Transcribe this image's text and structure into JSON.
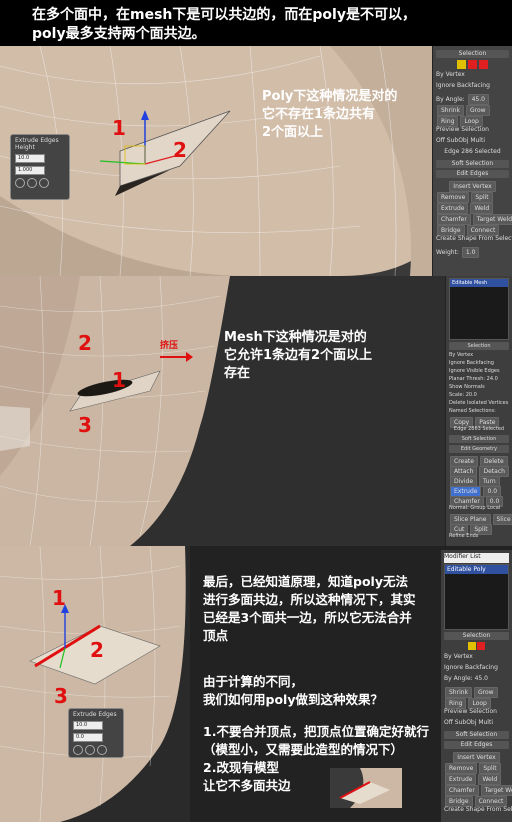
{
  "header": {
    "line1": "在多个面中，在mesh下是可以共边的，而在poly是不可以，",
    "line2": "poly最多支持两个面共边。"
  },
  "panel1": {
    "note": [
      "Poly下这种情况是对的",
      "它不存在1条边共有",
      "2个面以上"
    ],
    "marks": [
      "1",
      "2"
    ],
    "popup": {
      "title": "Extrude Edges",
      "subtitle": "Height",
      "v1": "10.0",
      "v2": "1.000"
    },
    "side": {
      "selection": "Selection",
      "by_vertex": "By Vertex",
      "ignore_backfacing": "Ignore Backfacing",
      "by_angle": "By Angle:",
      "angle_val": "45.0",
      "shrink": "Shrink",
      "grow": "Grow",
      "ring": "Ring",
      "loop": "Loop",
      "preview": "Preview Selection",
      "off": "Off",
      "subobj": "SubObj",
      "multi": "Multi",
      "status": "Edge 286 Selected",
      "soft": "Soft Selection",
      "edit_edges": "Edit Edges",
      "insert_vertex": "Insert Vertex",
      "remove": "Remove",
      "split": "Split",
      "extrude": "Extrude",
      "weld": "Weld",
      "chamfer": "Chamfer",
      "target_weld": "Target Weld",
      "bridge": "Bridge",
      "connect": "Connect",
      "create_shape": "Create Shape From Selection",
      "weight": "Weight:",
      "weight_val": "1.0"
    }
  },
  "panel2": {
    "note": [
      "Mesh下这种情况是对的",
      "它允许1条边有2个面以上",
      "存在"
    ],
    "marks": [
      "2",
      "1",
      "3"
    ],
    "arrow_label": "挤压",
    "side": {
      "modifier": "Editable Mesh",
      "selection": "Selection",
      "by_vertex": "By Vertex",
      "ignore_backfacing": "Ignore Backfacing",
      "ignore_visible": "Ignore Visible Edges",
      "planar": "Planar Thresh:",
      "planar_val": "24.0",
      "show_normals": "Show Normals",
      "scale": "Scale:",
      "scale_val": "20.0",
      "delete_isolated": "Delete Isolated Vertices",
      "named": "Named Selections:",
      "copy": "Copy",
      "paste": "Paste",
      "status": "Edge 2863 Selected",
      "soft": "Soft Selection",
      "edit_geometry": "Edit Geometry",
      "create": "Create",
      "delete": "Delete",
      "attach": "Attach",
      "detach": "Detach",
      "divide": "Divide",
      "turn": "Turn",
      "extrude": "Extrude",
      "extrude_val": "0.0",
      "chamfer": "Chamfer",
      "chamfer_val": "0.0",
      "normal": "Normal:",
      "group": "Group",
      "local": "Local",
      "slice_plane": "Slice Plane",
      "slice": "Slice",
      "cut": "Cut",
      "split": "Split",
      "refine": "Refine Ends"
    }
  },
  "panel3": {
    "note1": [
      "最后，已经知道原理，知道poly无法",
      "进行多面共边，所以这种情况下，其实",
      "已经是3个面共一边，所以它无法合并",
      "顶点"
    ],
    "note2": [
      "由于计算的不同，",
      "我们如何用poly做到这种效果？"
    ],
    "note3": [
      "1.不要合并顶点，把顶点位置确定好就行",
      "（模型小，又需要此造型的情况下）",
      "2.改现有模型",
      "让它不多面共边"
    ],
    "marks": [
      "1",
      "2",
      "3"
    ],
    "popup": {
      "title": "Extrude Edges",
      "v1": "10.0",
      "v2": "0.0"
    },
    "side": {
      "modifier_list": "Modifier List",
      "modifier": "Editable Poly",
      "selection": "Selection",
      "by_vertex": "By Vertex",
      "ignore_backfacing": "Ignore Backfacing",
      "by_angle": "By Angle:",
      "angle_val": "45.0",
      "shrink": "Shrink",
      "grow": "Grow",
      "ring": "Ring",
      "loop": "Loop",
      "preview": "Preview Selection",
      "off": "Off",
      "subobj": "SubObj",
      "multi": "Multi",
      "soft": "Soft Selection",
      "edit_edges": "Edit Edges",
      "insert_vertex": "Insert Vertex",
      "remove": "Remove",
      "split": "Split",
      "extrude": "Extrude",
      "weld": "Weld",
      "chamfer": "Chamfer",
      "target_weld": "Target Weld",
      "bridge": "Bridge",
      "connect": "Connect",
      "create_shape": "Create Shape From Selection"
    }
  },
  "colors": {
    "skin": "#cdb8a4",
    "skin_dark": "#b5a08d",
    "red": "#e01010",
    "viewport_bg": "#3c3c3c"
  }
}
